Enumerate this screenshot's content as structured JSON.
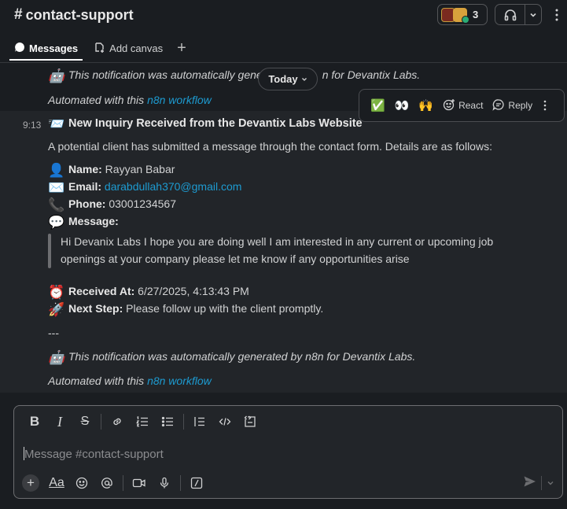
{
  "header": {
    "channel_hash": "#",
    "channel_name": "contact-support",
    "member_count": "3"
  },
  "tabs": [
    {
      "label": "Messages",
      "icon": "messages-icon"
    },
    {
      "label": "Add canvas",
      "icon": "canvas-icon"
    }
  ],
  "previous_message": {
    "footer_emoji": "🤖",
    "footer_start": "This notification was automatically gene",
    "footer_end": "n for Devantix Labs.",
    "automated_prefix": "Automated with this ",
    "automated_link": "n8n workflow"
  },
  "date_divider": "Today",
  "hover_actions": {
    "reactions": [
      "✅",
      "👀",
      "🙌"
    ],
    "react_label": "React",
    "reply_label": "Reply"
  },
  "message": {
    "time": "9:13",
    "title_emoji": "📨",
    "title": "New Inquiry Received from the Devantix Labs Website",
    "intro": "A potential client has submitted a message through the contact form. Details are as follows:",
    "name_emoji": "👤",
    "name_label": "Name:",
    "name_value": " Rayyan Babar",
    "email_emoji": "✉️",
    "email_label": "Email:",
    "email_value": "darabdullah370@gmail.com",
    "phone_emoji": "📞",
    "phone_label": "Phone:",
    "phone_value": " 03001234567",
    "message_emoji": "💬",
    "message_label": "Message:",
    "message_line1": "Hi Devanix Labs I hope you are doing well I am interested in any current or upcoming job",
    "message_line2": "openings at your company please let me know if any opportunities arise",
    "received_emoji": "⏰",
    "received_label": "Received At:",
    "received_value": " 6/27/2025, 4:13:43 PM",
    "next_emoji": "🚀",
    "next_label": "Next Step:",
    "next_value": " Please follow up with the client promptly.",
    "divider": "---",
    "footer_emoji": "🤖",
    "footer": "This notification was automatically generated by n8n for Devantix Labs.",
    "automated_prefix": "Automated with this ",
    "automated_link": "n8n workflow"
  },
  "composer": {
    "placeholder": "Message #contact-support"
  },
  "colors": {
    "background": "#1a1d21",
    "message_bg": "#222529",
    "link": "#1d9bd1",
    "text": "#d1d2d3"
  }
}
